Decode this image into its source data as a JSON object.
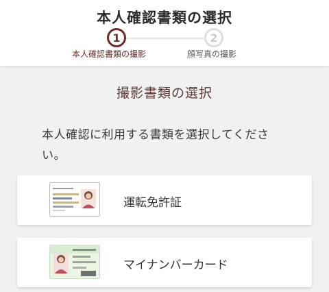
{
  "header": {
    "title": "本人確認書類の選択",
    "steps": [
      {
        "number": "1",
        "label": "本人確認書類の撮影",
        "active": true
      },
      {
        "number": "2",
        "label": "顔写真の撮影",
        "active": false
      }
    ]
  },
  "main": {
    "section_title": "撮影書類の選択",
    "instruction": "本人確認に利用する書類を選択してください。",
    "documents": [
      {
        "label": "運転免許証",
        "icon": "drivers-license-icon"
      },
      {
        "label": "マイナンバーカード",
        "icon": "my-number-card-icon"
      }
    ]
  },
  "colors": {
    "accent": "#6b2c2c",
    "inactive": "#dedede",
    "background": "#f2f1f1"
  }
}
